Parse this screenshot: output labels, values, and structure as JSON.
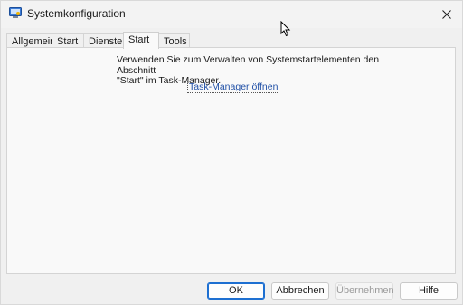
{
  "window": {
    "title": "Systemkonfiguration"
  },
  "icons": {
    "app": "system-config-icon",
    "close": "close-icon",
    "cursor": "mouse-cursor-icon"
  },
  "tabs": [
    {
      "label": "Allgemein"
    },
    {
      "label": "Start"
    },
    {
      "label": "Dienste"
    },
    {
      "label": "Start",
      "active": true
    },
    {
      "label": "Tools"
    }
  ],
  "startup": {
    "description": "Verwenden Sie zum Verwalten von Systemstartelementen den Abschnitt\n\"Start\" im Task-Manager.",
    "link": "Task-Manager öffnen"
  },
  "buttons": {
    "ok": "OK",
    "cancel": "Abbrechen",
    "apply": "Übernehmen",
    "help": "Hilfe"
  },
  "colors": {
    "accent": "#1d6fd1",
    "link": "#1f4fa6"
  }
}
